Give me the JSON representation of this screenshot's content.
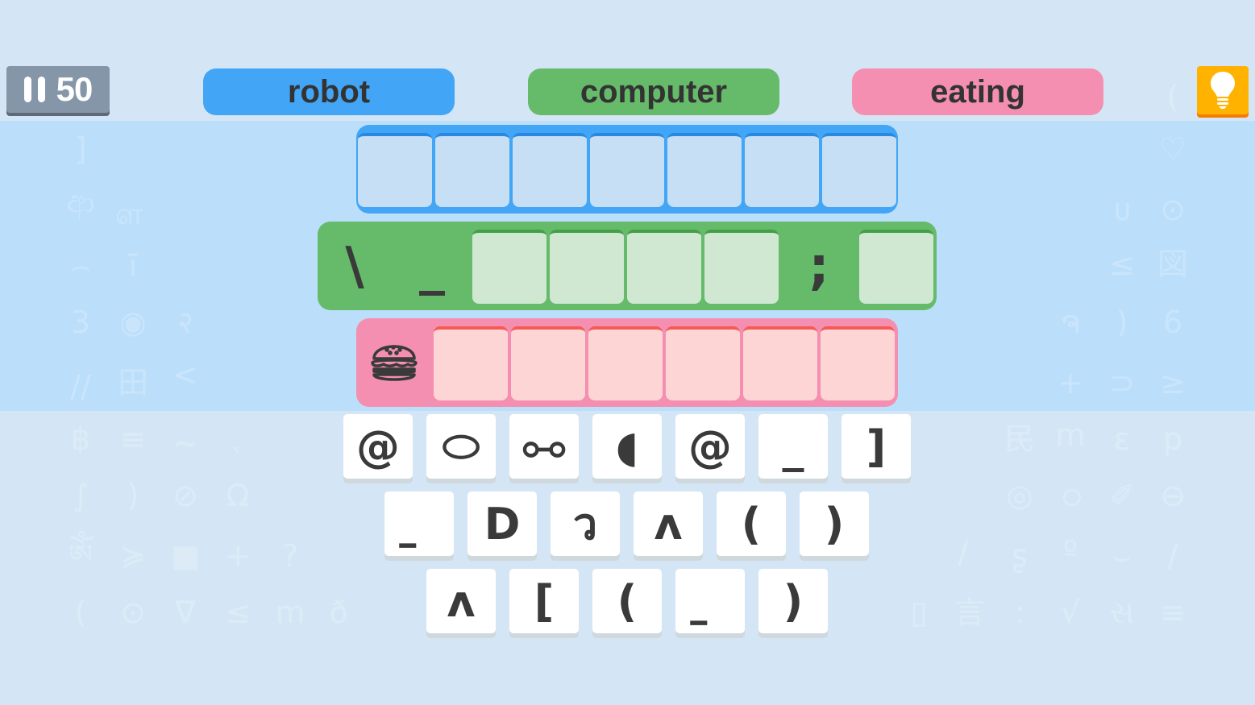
{
  "timer": {
    "icon": "pause-icon",
    "value": "50"
  },
  "categories": [
    {
      "label": "robot",
      "color": "#42a5f5"
    },
    {
      "label": "computer",
      "color": "#66bb6a"
    },
    {
      "label": "eating",
      "color": "#f48fb1"
    }
  ],
  "hint": {
    "icon": "lightbulb-icon"
  },
  "answer_rows": [
    {
      "category": "robot",
      "frame_color": "#42a5f5",
      "slot_color": "#c6dff5",
      "slot_top_color": "#2989e0",
      "cells": [
        {
          "type": "slot",
          "value": ""
        },
        {
          "type": "slot",
          "value": ""
        },
        {
          "type": "slot",
          "value": ""
        },
        {
          "type": "slot",
          "value": ""
        },
        {
          "type": "slot",
          "value": ""
        },
        {
          "type": "slot",
          "value": ""
        },
        {
          "type": "slot",
          "value": ""
        }
      ]
    },
    {
      "category": "computer",
      "frame_color": "#66bb6a",
      "slot_color": "#d0e7d1",
      "slot_top_color": "#43a047",
      "cells": [
        {
          "type": "fixed",
          "value": "\\"
        },
        {
          "type": "fixed",
          "value": "_"
        },
        {
          "type": "slot",
          "value": ""
        },
        {
          "type": "slot",
          "value": ""
        },
        {
          "type": "slot",
          "value": ""
        },
        {
          "type": "slot",
          "value": ""
        },
        {
          "type": "fixed",
          "value": ";"
        },
        {
          "type": "slot",
          "value": ""
        }
      ]
    },
    {
      "category": "eating",
      "frame_color": "#f48fb1",
      "slot_color": "#fdd5d5",
      "slot_top_color": "#f55a55",
      "icon": "burger-icon",
      "cells": [
        {
          "type": "slot",
          "value": ""
        },
        {
          "type": "slot",
          "value": ""
        },
        {
          "type": "slot",
          "value": ""
        },
        {
          "type": "slot",
          "value": ""
        },
        {
          "type": "slot",
          "value": ""
        },
        {
          "type": "slot",
          "value": ""
        }
      ]
    }
  ],
  "tiles": [
    [
      "@",
      "⬭",
      "⧟",
      "◖",
      "@",
      "_",
      "]"
    ],
    [
      "॒",
      "D",
      "ว",
      "ʌ",
      "(",
      ")"
    ],
    [
      "ʌ",
      "[",
      "(",
      "॒",
      ")"
    ]
  ],
  "background_glyphs": {
    "left": [
      "]",
      "ආ",
      "ள",
      "⌢",
      "ī",
      "3",
      "◉",
      "२",
      "//",
      "田",
      "<",
      "฿",
      "≡",
      "~",
      "ˎ",
      "∫",
      ")",
      "⊘",
      "Ω",
      "ༀ",
      "≽",
      "■",
      "+",
      "?",
      "(",
      "⊙",
      "∇",
      "≤",
      "m",
      "ð"
    ],
    "right": [
      "♡",
      "ᴜ",
      "⊙",
      "≤",
      "図",
      "ຈ",
      ")",
      "6",
      "+",
      "⊃",
      "≥",
      "⺠",
      "m",
      "ε",
      "p",
      "◎",
      "ഠ",
      "✐",
      "⊖",
      "/",
      "ʂ",
      "º",
      "⌣",
      "/",
      "▯",
      "言",
      ":",
      "√",
      "સ",
      "≡",
      "("
    ]
  }
}
